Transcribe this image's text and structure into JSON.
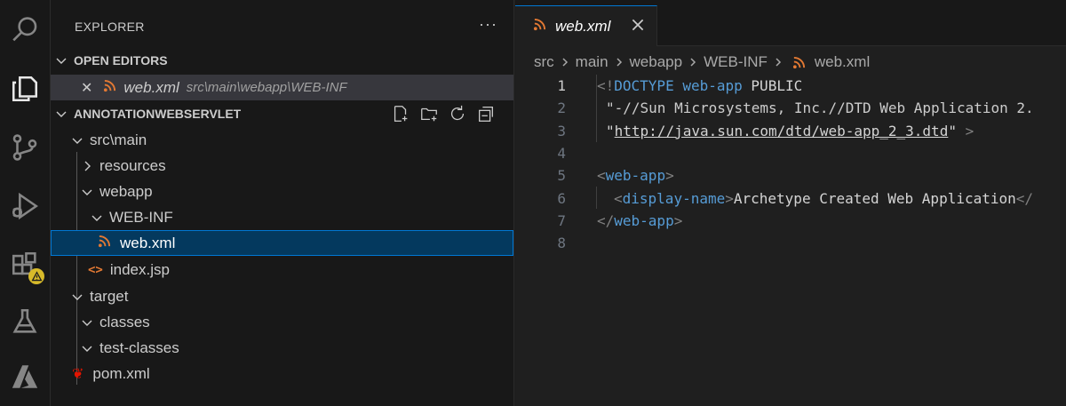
{
  "activity_bar": {
    "items": [
      {
        "name": "search"
      },
      {
        "name": "explorer"
      },
      {
        "name": "source-control"
      },
      {
        "name": "run-and-debug"
      },
      {
        "name": "extensions"
      },
      {
        "name": "testing"
      },
      {
        "name": "azure"
      }
    ]
  },
  "sidebar": {
    "title": "EXPLORER",
    "more": "···",
    "open_editors": {
      "label": "OPEN EDITORS",
      "items": [
        {
          "close": "✕",
          "name": "web.xml",
          "path": "src\\main\\webapp\\WEB-INF"
        }
      ]
    },
    "project": {
      "label": "ANNOTATIONWEBSERVLET",
      "tree": {
        "src_main": "src\\main",
        "resources": "resources",
        "webapp": "webapp",
        "web_inf": "WEB-INF",
        "web_xml": "web.xml",
        "index_jsp": "index.jsp",
        "target": "target",
        "classes": "classes",
        "test_classes": "test-classes",
        "pom_xml": "pom.xml"
      }
    }
  },
  "editor": {
    "tab": {
      "label": "web.xml"
    },
    "breadcrumb": [
      "src",
      "main",
      "webapp",
      "WEB-INF",
      "web.xml"
    ],
    "line_numbers": [
      "1",
      "2",
      "3",
      "4",
      "5",
      "6",
      "7",
      "8"
    ],
    "code": {
      "l1_open": "<!",
      "l1_doctype": "DOCTYPE",
      "l1_name": "web-app",
      "l1_public": "PUBLIC",
      "l2": "\"-//Sun Microsystems, Inc.//DTD Web Application 2.",
      "l3_q1": "\"",
      "l3_url": "http://java.sun.com/dtd/web-app_2_3.dtd",
      "l3_q2": "\"",
      "l3_close": " >",
      "l5_open": "<",
      "l5_tag": "web-app",
      "l5_close": ">",
      "l6_open": "<",
      "l6_tag": "display-name",
      "l6_close": ">",
      "l6_text": "Archetype Created Web Application",
      "l6_end": "</",
      "l7_open": "</",
      "l7_tag": "web-app",
      "l7_close": ">"
    }
  },
  "colors": {
    "accent": "#0078d4",
    "tag": "#569cd6",
    "rss": "#e37933",
    "warning": "#d7ba2a"
  }
}
